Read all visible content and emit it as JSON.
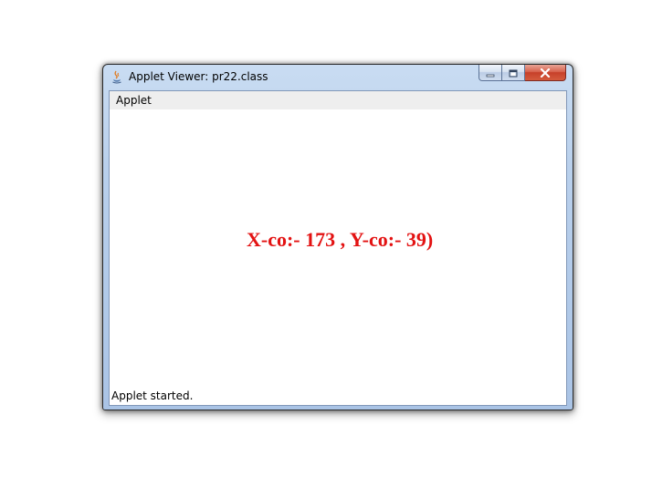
{
  "window": {
    "title": "Applet Viewer: pr22.class",
    "icon": "java-icon",
    "controls": {
      "minimize": "minimize-icon",
      "maximize": "maximize-icon",
      "close": "close-icon"
    }
  },
  "menubar": {
    "items": [
      {
        "label": "Applet"
      }
    ]
  },
  "canvas": {
    "text": "X-co:- 173 , Y-co:- 39)",
    "text_color": "#e31212"
  },
  "status": {
    "text": "Applet started."
  }
}
